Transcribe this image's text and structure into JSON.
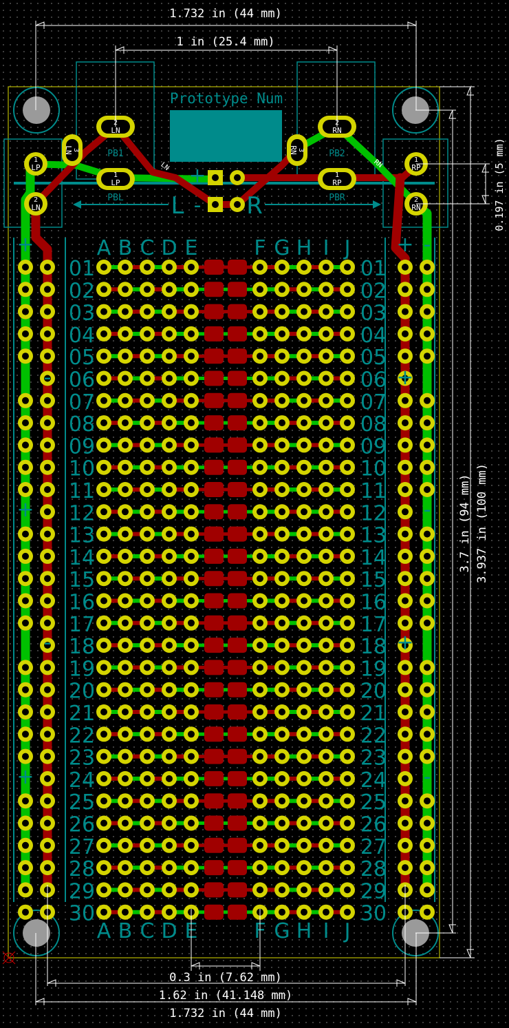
{
  "board_title": "Prototype Num",
  "dimensions": {
    "top_width": "1.732 in (44 mm)",
    "button_spacing": "1 in (25.4 mm)",
    "jack_offset": "0.197 in (5 mm)",
    "inner_height": "3.7 in (94 mm)",
    "outer_height": "3.937 in (100 mm)",
    "channel_gap": "0.3 in (7.62 mm)",
    "hole_span": "1.62 in (41.148 mm)",
    "bottom_width": "1.732 in (44 mm)"
  },
  "columns_left": [
    "A",
    "B",
    "C",
    "D",
    "E"
  ],
  "columns_right": [
    "F",
    "G",
    "H",
    "I",
    "J"
  ],
  "rows": [
    "01",
    "02",
    "03",
    "04",
    "05",
    "06",
    "07",
    "08",
    "09",
    "10",
    "11",
    "12",
    "13",
    "14",
    "15",
    "16",
    "17",
    "18",
    "19",
    "20",
    "21",
    "22",
    "23",
    "24",
    "25",
    "26",
    "27",
    "28",
    "29",
    "30"
  ],
  "rail_signs": {
    "plus": "+",
    "minus": "-"
  },
  "power_labels": {
    "left": "L",
    "right": "R",
    "plus": "+",
    "minus": "-"
  },
  "components": {
    "pb1_ref": "PB1",
    "pbl_ref": "PBL",
    "pb2_ref": "PB2",
    "pbr_ref": "PBR",
    "pb1_pin2": {
      "num": "2",
      "net": "LN"
    },
    "pb1_pin1": {
      "num": "1",
      "net": "LP"
    },
    "pb1_pin3": {
      "num": "3",
      "net": "LN"
    },
    "pb2_pin2": {
      "num": "2",
      "net": "RN"
    },
    "pb2_pin1": {
      "num": "1",
      "net": "RP"
    },
    "pb2_pin3": {
      "num": "3",
      "net": "RN"
    },
    "jl_pin1": {
      "num": "1",
      "net": "LP"
    },
    "jl_pin2": {
      "num": "2",
      "net": "LN"
    },
    "jr_pin1": {
      "num": "1",
      "net": "RP"
    },
    "jr_pin2": {
      "num": "2",
      "net": "RN"
    },
    "trace_ln": "LN",
    "trace_rn": "RN"
  },
  "colors": {
    "pad": "#d4d400",
    "green": "#00c000",
    "red": "#a00000",
    "silk": "#008b8b",
    "edge": "#b8b800",
    "dim": "#ffffff"
  }
}
